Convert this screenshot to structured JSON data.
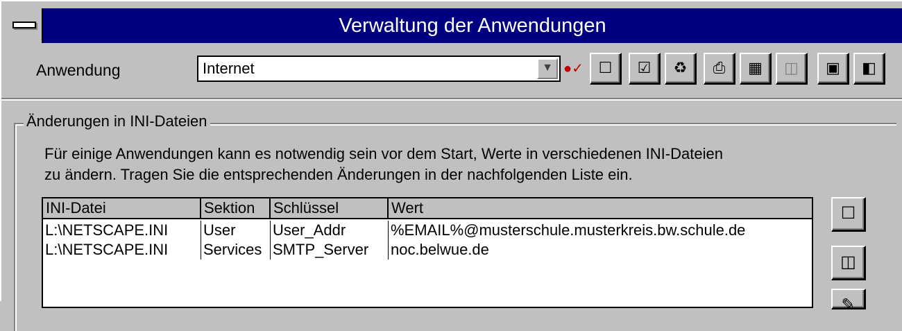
{
  "window": {
    "title": "Verwaltung der Anwendungen"
  },
  "toolbar": {
    "label": "Anwendung",
    "application_value": "Internet",
    "buttons": [
      {
        "icon": "new-icon",
        "glyph": "☐"
      },
      {
        "icon": "check-icon",
        "glyph": "☑"
      },
      {
        "icon": "trash-icon",
        "glyph": "🗑"
      },
      {
        "icon": "print-icon",
        "glyph": "🖶"
      },
      {
        "icon": "film-icon",
        "glyph": "▦"
      },
      {
        "icon": "open-folder-icon",
        "glyph": "📂"
      },
      {
        "icon": "save-icon",
        "glyph": "💾"
      },
      {
        "icon": "exit-door-icon",
        "glyph": "🚪"
      }
    ]
  },
  "group": {
    "title": "Änderungen in INI-Dateien",
    "description_line1": "Für einige Anwendungen kann es notwendig sein vor dem Start, Werte in verschiedenen INI-Dateien",
    "description_line2": "zu ändern. Tragen Sie die entsprechenden Änderungen in der nachfolgenden Liste ein."
  },
  "table": {
    "columns": [
      "INI-Datei",
      "Sektion",
      "Schlüssel",
      "Wert"
    ],
    "rows": [
      [
        "L:\\NETSCAPE.INI",
        "User",
        "User_Addr",
        "%EMAIL%@musterschule.musterkreis.bw.schule.de"
      ],
      [
        "L:\\NETSCAPE.INI",
        "Services",
        "SMTP_Server",
        "noc.belwue.de"
      ]
    ]
  },
  "side_buttons": [
    {
      "icon": "new-entry-icon",
      "glyph": "☐"
    },
    {
      "icon": "open-file-icon",
      "glyph": "📂"
    }
  ]
}
